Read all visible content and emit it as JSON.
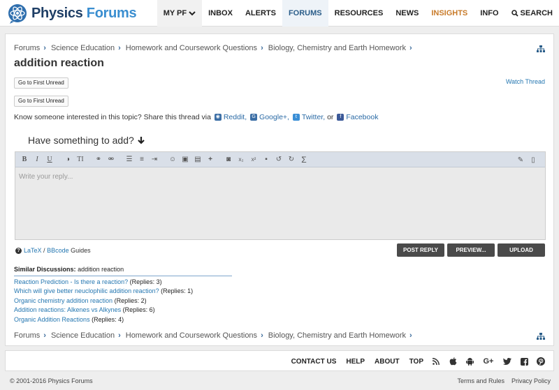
{
  "header": {
    "logo_text_main": "Physics",
    "logo_text_accent": "Forums",
    "nav": [
      {
        "label": "MY PF",
        "icon": "chevron-down-icon"
      },
      {
        "label": "INBOX"
      },
      {
        "label": "ALERTS"
      },
      {
        "label": "FORUMS"
      },
      {
        "label": "RESOURCES"
      },
      {
        "label": "NEWS"
      },
      {
        "label": "INSIGHTS"
      },
      {
        "label": "INFO"
      },
      {
        "label": "SEARCH",
        "icon": "search-icon"
      }
    ],
    "colors": {
      "brand_dark": "#1f3f66",
      "brand_light": "#3a8ed0",
      "insights": "#c87b2a"
    }
  },
  "breadcrumb": [
    "Forums",
    "Science Education",
    "Homework and Coursework Questions",
    "Biology, Chemistry and Earth Homework"
  ],
  "thread": {
    "title": "addition reaction",
    "first_unread_1": "Go to First Unread",
    "first_unread_2": "Go to First Unread",
    "watch": "Watch Thread"
  },
  "share": {
    "prefix": "Know someone interested in this topic? Share this thread via",
    "reddit": "Reddit,",
    "google": "Google+,",
    "twitter": "Twitter,",
    "or": "or",
    "facebook": "Facebook"
  },
  "reply": {
    "heading": "Have something to add?",
    "placeholder": "Write your reply...",
    "toolbar_icons": [
      "bold-icon",
      "italic-icon",
      "underline-icon",
      "color-icon",
      "text-size-icon",
      "link-icon",
      "unlink-icon",
      "bullet-list-icon",
      "numbered-list-icon",
      "indent-icon",
      "smilie-icon",
      "image-icon",
      "media-icon",
      "insert-icon",
      "camera-icon",
      "subscript-icon",
      "superscript-icon",
      "save-draft-icon",
      "undo-icon",
      "redo-icon",
      "sigma-icon",
      "eraser-icon",
      "source-icon"
    ],
    "guides_latex": "LaTeX",
    "guides_sep": "/",
    "guides_bbcode": "BBcode",
    "guides_suffix": "Guides",
    "post_reply": "POST REPLY",
    "preview": "PREVIEW...",
    "upload": "UPLOAD"
  },
  "similar": {
    "label": "Similar Discussions:",
    "topic": "addition reaction",
    "items": [
      {
        "title": "Reaction Prediction - Is there a reaction?",
        "replies": "(Replies: 3)"
      },
      {
        "title": "Which will give better neuclophilic addition reaction?",
        "replies": "(Replies: 1)"
      },
      {
        "title": "Organic chemistry addition reaction",
        "replies": "(Replies: 2)"
      },
      {
        "title": "Addition reactions: Alkenes vs Alkynes",
        "replies": "(Replies: 6)"
      },
      {
        "title": "Organic Addition Reactions",
        "replies": "(Replies: 4)"
      }
    ]
  },
  "footer": {
    "links": [
      "CONTACT US",
      "HELP",
      "ABOUT",
      "TOP"
    ],
    "social_icons": [
      "rss-icon",
      "apple-icon",
      "android-icon",
      "google-plus-icon",
      "twitter-icon",
      "facebook-icon",
      "pinterest-icon"
    ],
    "copyright": "© 2001-2016 Physics Forums",
    "terms": "Terms and Rules",
    "privacy": "Privacy Policy"
  }
}
